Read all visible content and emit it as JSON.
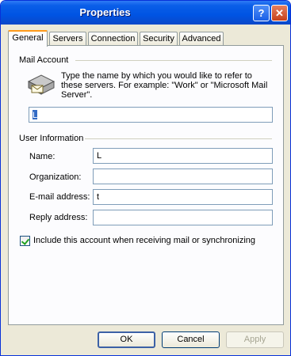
{
  "window": {
    "title": "Properties",
    "help_glyph": "?",
    "close_glyph": "✕"
  },
  "tabs": [
    {
      "label": "General",
      "active": true
    },
    {
      "label": "Servers",
      "active": false
    },
    {
      "label": "Connection",
      "active": false
    },
    {
      "label": "Security",
      "active": false
    },
    {
      "label": "Advanced",
      "active": false
    }
  ],
  "mail_account": {
    "section_label": "Mail Account",
    "description": "Type the name by which you would like to refer to these servers.  For example: \"Work\" or \"Microsoft Mail Server\".",
    "account_name_value": "L",
    "icon": "mail-server-icon"
  },
  "user_information": {
    "section_label": "User Information",
    "name_label": "Name:",
    "name_value": "L",
    "organization_label": "Organization:",
    "organization_value": "",
    "email_label": "E-mail address:",
    "email_value": "t",
    "reply_label": "Reply address:",
    "reply_value": ""
  },
  "include_account": {
    "label": "Include this account when receiving mail or synchronizing",
    "checked": true
  },
  "buttons": {
    "ok": "OK",
    "cancel": "Cancel",
    "apply": "Apply"
  },
  "colors": {
    "titlebar": "#0054e3",
    "tab_highlight": "#ff9a1a",
    "check": "#21a121"
  }
}
